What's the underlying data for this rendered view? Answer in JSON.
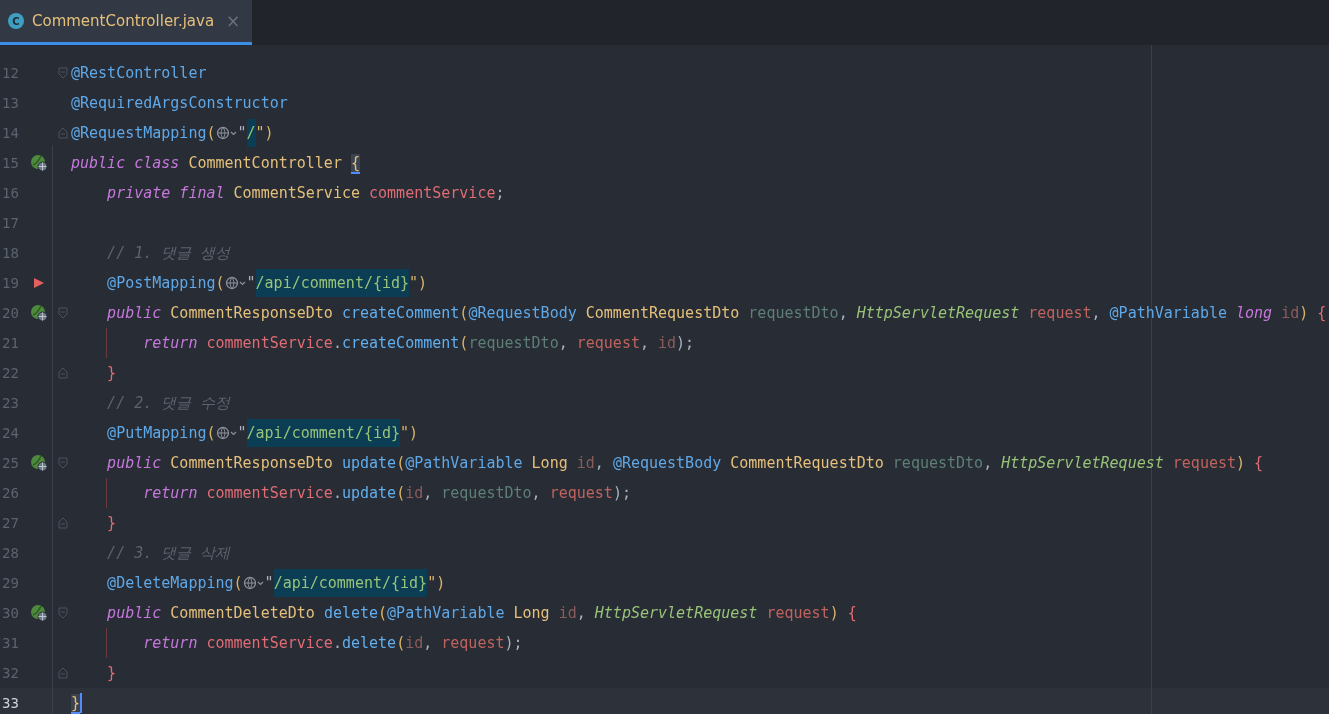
{
  "tabs": [
    {
      "label": "CommentController.java",
      "icon": "C",
      "close": "×",
      "selected": true
    }
  ],
  "lines": [
    {
      "number": "12",
      "bean": false,
      "marker": false,
      "fold_start": true,
      "fold_end": false,
      "current": false,
      "guide": false,
      "tokens": [
        {
          "text": "@RestController",
          "kind": "annotation"
        }
      ]
    },
    {
      "number": "13",
      "bean": false,
      "marker": false,
      "fold_start": false,
      "fold_end": false,
      "current": false,
      "guide": false,
      "tokens": [
        {
          "text": "@RequiredArgsConstructor",
          "kind": "annotation"
        }
      ]
    },
    {
      "number": "14",
      "bean": false,
      "marker": false,
      "fold_start": false,
      "fold_end": true,
      "current": false,
      "guide": false,
      "tokens": [
        {
          "text": "@RequestMapping",
          "kind": "annotation"
        },
        {
          "text": "(",
          "kind": "bracket"
        },
        {
          "kind": "inlay"
        },
        {
          "text": "\"",
          "kind": "plain"
        },
        {
          "text": "/",
          "kind": "string",
          "highlighted": true
        },
        {
          "text": "\")",
          "kind": "bracket"
        }
      ]
    },
    {
      "number": "15",
      "bean": true,
      "marker": false,
      "fold_start": false,
      "fold_end": false,
      "current": false,
      "guide": false,
      "tokens": [
        {
          "text": "public class ",
          "kind": "keyword"
        },
        {
          "text": "CommentController ",
          "kind": "type"
        },
        {
          "text": "{",
          "kind": "brace_match"
        }
      ]
    },
    {
      "number": "16",
      "bean": false,
      "marker": false,
      "fold_start": false,
      "fold_end": false,
      "current": false,
      "guide": false,
      "tokens": [
        {
          "text": "    private final ",
          "kind": "keyword"
        },
        {
          "text": "CommentService ",
          "kind": "type"
        },
        {
          "text": "commentService",
          "kind": "field"
        },
        {
          "text": ";",
          "kind": "plain"
        }
      ]
    },
    {
      "number": "17",
      "bean": false,
      "marker": false,
      "fold_start": false,
      "fold_end": false,
      "current": false,
      "guide": false
    },
    {
      "number": "18",
      "bean": false,
      "marker": false,
      "fold_start": false,
      "fold_end": false,
      "current": false,
      "guide": false,
      "tokens": [
        {
          "text": "    // 1. 댓글 생성",
          "kind": "comment"
        }
      ]
    },
    {
      "number": "19",
      "bean": false,
      "marker": true,
      "fold_start": false,
      "fold_end": false,
      "current": false,
      "guide": false,
      "tokens": [
        {
          "text": "    @PostMapping",
          "kind": "annotation"
        },
        {
          "text": "(",
          "kind": "bracket"
        },
        {
          "kind": "inlay"
        },
        {
          "text": "\"",
          "kind": "plain"
        },
        {
          "text": "/api/comment/{id}",
          "kind": "string",
          "highlighted": true
        },
        {
          "text": "\")",
          "kind": "bracket"
        }
      ]
    },
    {
      "number": "20",
      "bean": true,
      "marker": false,
      "fold_start": true,
      "fold_end": false,
      "current": false,
      "guide": false,
      "tokens": [
        {
          "text": "    public ",
          "kind": "keyword"
        },
        {
          "text": "CommentResponseDto ",
          "kind": "type"
        },
        {
          "text": "createComment",
          "kind": "method"
        },
        {
          "text": "(",
          "kind": "bracket"
        },
        {
          "text": "@RequestBody ",
          "kind": "annotation"
        },
        {
          "text": "CommentRequestDto ",
          "kind": "type"
        },
        {
          "text": "requestDto",
          "kind": "param_unused"
        },
        {
          "text": ", ",
          "kind": "plain"
        },
        {
          "text": "HttpServletRequest ",
          "kind": "interface"
        },
        {
          "text": "request",
          "kind": "param"
        },
        {
          "text": ", ",
          "kind": "plain"
        },
        {
          "text": "@PathVariable ",
          "kind": "annotation"
        },
        {
          "text": "long ",
          "kind": "keyword"
        },
        {
          "text": "id",
          "kind": "param_dim"
        },
        {
          "text": ") ",
          "kind": "bracket"
        },
        {
          "text": "{",
          "kind": "brace"
        }
      ]
    },
    {
      "number": "21",
      "bean": false,
      "marker": false,
      "fold_start": false,
      "fold_end": false,
      "current": false,
      "guide": true,
      "tokens": [
        {
          "text": "        return ",
          "kind": "keyword"
        },
        {
          "text": "commentService",
          "kind": "field"
        },
        {
          "text": ".",
          "kind": "plain"
        },
        {
          "text": "createComment",
          "kind": "method"
        },
        {
          "text": "(",
          "kind": "bracket"
        },
        {
          "text": "requestDto",
          "kind": "param_unused"
        },
        {
          "text": ", ",
          "kind": "plain"
        },
        {
          "text": "request",
          "kind": "param"
        },
        {
          "text": ", ",
          "kind": "plain"
        },
        {
          "text": "id",
          "kind": "param_dim"
        },
        {
          "text": ");",
          "kind": "plain"
        }
      ]
    },
    {
      "number": "22",
      "bean": false,
      "marker": false,
      "fold_start": false,
      "fold_end": true,
      "current": false,
      "guide": false,
      "tokens": [
        {
          "text": "    }",
          "kind": "brace"
        }
      ]
    },
    {
      "number": "23",
      "bean": false,
      "marker": false,
      "fold_start": false,
      "fold_end": false,
      "current": false,
      "guide": false,
      "tokens": [
        {
          "text": "    // 2. 댓글 수정",
          "kind": "comment"
        }
      ]
    },
    {
      "number": "24",
      "bean": false,
      "marker": false,
      "fold_start": false,
      "fold_end": false,
      "current": false,
      "guide": false,
      "tokens": [
        {
          "text": "    @PutMapping",
          "kind": "annotation"
        },
        {
          "text": "(",
          "kind": "bracket"
        },
        {
          "kind": "inlay"
        },
        {
          "text": "\"",
          "kind": "plain"
        },
        {
          "text": "/api/comment/{id}",
          "kind": "string",
          "highlighted": true
        },
        {
          "text": "\")",
          "kind": "bracket"
        }
      ]
    },
    {
      "number": "25",
      "bean": true,
      "marker": false,
      "fold_start": true,
      "fold_end": false,
      "current": false,
      "guide": false,
      "tokens": [
        {
          "text": "    public ",
          "kind": "keyword"
        },
        {
          "text": "CommentResponseDto ",
          "kind": "type"
        },
        {
          "text": "update",
          "kind": "method"
        },
        {
          "text": "(",
          "kind": "bracket"
        },
        {
          "text": "@PathVariable ",
          "kind": "annotation"
        },
        {
          "text": "Long ",
          "kind": "type"
        },
        {
          "text": "id",
          "kind": "param_dim"
        },
        {
          "text": ", ",
          "kind": "plain"
        },
        {
          "text": "@RequestBody ",
          "kind": "annotation"
        },
        {
          "text": "CommentRequestDto ",
          "kind": "type"
        },
        {
          "text": "requestDto",
          "kind": "param_unused"
        },
        {
          "text": ", ",
          "kind": "plain"
        },
        {
          "text": "HttpServletRequest ",
          "kind": "interface"
        },
        {
          "text": "request",
          "kind": "param"
        },
        {
          "text": ") ",
          "kind": "bracket"
        },
        {
          "text": "{",
          "kind": "brace"
        }
      ]
    },
    {
      "number": "26",
      "bean": false,
      "marker": false,
      "fold_start": false,
      "fold_end": false,
      "current": false,
      "guide": true,
      "tokens": [
        {
          "text": "        return ",
          "kind": "keyword"
        },
        {
          "text": "commentService",
          "kind": "field"
        },
        {
          "text": ".",
          "kind": "plain"
        },
        {
          "text": "update",
          "kind": "method"
        },
        {
          "text": "(",
          "kind": "bracket"
        },
        {
          "text": "id",
          "kind": "param_dim"
        },
        {
          "text": ", ",
          "kind": "plain"
        },
        {
          "text": "requestDto",
          "kind": "param_unused"
        },
        {
          "text": ", ",
          "kind": "plain"
        },
        {
          "text": "request",
          "kind": "param"
        },
        {
          "text": ");",
          "kind": "plain"
        }
      ]
    },
    {
      "number": "27",
      "bean": false,
      "marker": false,
      "fold_start": false,
      "fold_end": true,
      "current": false,
      "guide": false,
      "tokens": [
        {
          "text": "    }",
          "kind": "brace"
        }
      ]
    },
    {
      "number": "28",
      "bean": false,
      "marker": false,
      "fold_start": false,
      "fold_end": false,
      "current": false,
      "guide": false,
      "tokens": [
        {
          "text": "    // 3. 댓글 삭제",
          "kind": "comment"
        }
      ]
    },
    {
      "number": "29",
      "bean": false,
      "marker": false,
      "fold_start": false,
      "fold_end": false,
      "current": false,
      "guide": false,
      "tokens": [
        {
          "text": "    @DeleteMapping",
          "kind": "annotation"
        },
        {
          "text": "(",
          "kind": "bracket"
        },
        {
          "kind": "inlay"
        },
        {
          "text": "\"",
          "kind": "plain"
        },
        {
          "text": "/api/comment/{id}",
          "kind": "string",
          "highlighted": true
        },
        {
          "text": "\")",
          "kind": "bracket"
        }
      ]
    },
    {
      "number": "30",
      "bean": true,
      "marker": false,
      "fold_start": true,
      "fold_end": false,
      "current": false,
      "guide": false,
      "tokens": [
        {
          "text": "    public ",
          "kind": "keyword"
        },
        {
          "text": "CommentDeleteDto ",
          "kind": "type"
        },
        {
          "text": "delete",
          "kind": "method"
        },
        {
          "text": "(",
          "kind": "bracket"
        },
        {
          "text": "@PathVariable ",
          "kind": "annotation"
        },
        {
          "text": "Long ",
          "kind": "type"
        },
        {
          "text": "id",
          "kind": "param_dim"
        },
        {
          "text": ", ",
          "kind": "plain"
        },
        {
          "text": "HttpServletRequest ",
          "kind": "interface"
        },
        {
          "text": "request",
          "kind": "param"
        },
        {
          "text": ") ",
          "kind": "bracket"
        },
        {
          "text": "{",
          "kind": "brace"
        }
      ]
    },
    {
      "number": "31",
      "bean": false,
      "marker": false,
      "fold_start": false,
      "fold_end": false,
      "current": false,
      "guide": true,
      "tokens": [
        {
          "text": "        return ",
          "kind": "keyword"
        },
        {
          "text": "commentService",
          "kind": "field"
        },
        {
          "text": ".",
          "kind": "plain"
        },
        {
          "text": "delete",
          "kind": "method"
        },
        {
          "text": "(",
          "kind": "bracket"
        },
        {
          "text": "id",
          "kind": "param_dim"
        },
        {
          "text": ", ",
          "kind": "plain"
        },
        {
          "text": "request",
          "kind": "param"
        },
        {
          "text": ");",
          "kind": "plain"
        }
      ]
    },
    {
      "number": "32",
      "bean": false,
      "marker": false,
      "fold_start": false,
      "fold_end": true,
      "current": false,
      "guide": false,
      "tokens": [
        {
          "text": "    }",
          "kind": "brace"
        }
      ]
    },
    {
      "number": "33",
      "bean": false,
      "marker": false,
      "fold_start": false,
      "fold_end": false,
      "current": true,
      "guide": false,
      "tokens": [
        {
          "text": "}",
          "kind": "brace_match"
        }
      ]
    }
  ]
}
